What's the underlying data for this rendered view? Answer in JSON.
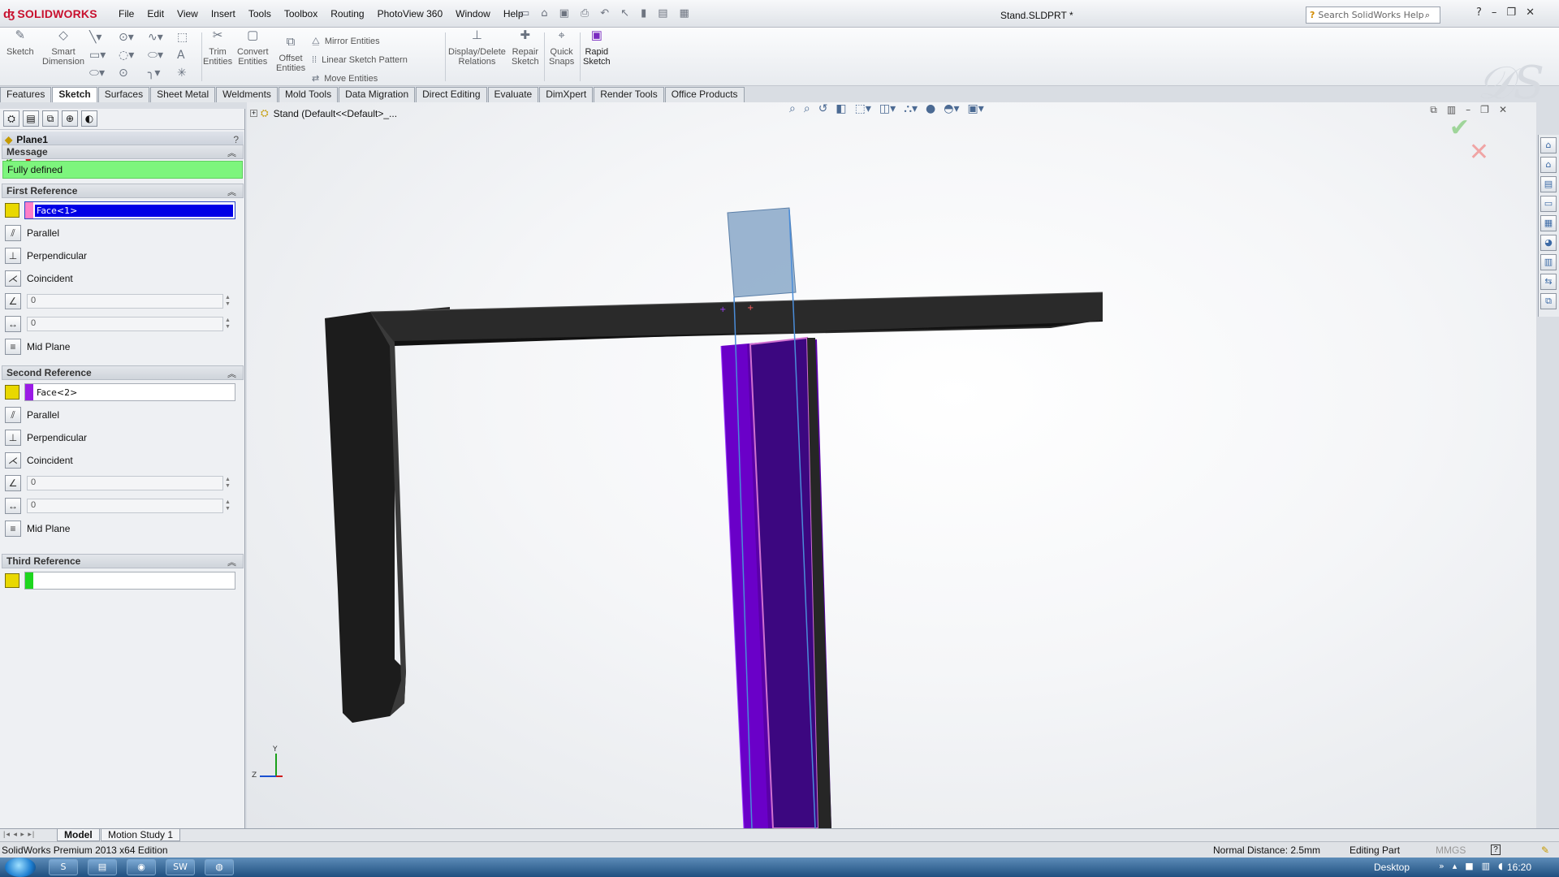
{
  "app": {
    "logo_text": "SOLIDWORKS",
    "menus": [
      "File",
      "Edit",
      "View",
      "Insert",
      "Tools",
      "Toolbox",
      "Routing",
      "PhotoView 360",
      "Window",
      "Help"
    ],
    "document_title": "Stand.SLDPRT *",
    "search_placeholder": "Search SolidWorks Help"
  },
  "command_manager": {
    "sketch": "Sketch",
    "smart_dimension_1": "Smart",
    "smart_dimension_2": "Dimension",
    "trim_1": "Trim",
    "trim_2": "Entities",
    "convert_1": "Convert",
    "convert_2": "Entities",
    "offset_1": "Offset",
    "offset_2": "Entities",
    "mirror": "Mirror Entities",
    "linear_pattern": "Linear Sketch Pattern",
    "move": "Move Entities",
    "display_delete_1": "Display/Delete",
    "display_delete_2": "Relations",
    "repair_1": "Repair",
    "repair_2": "Sketch",
    "quick_snaps_1": "Quick",
    "quick_snaps_2": "Snaps",
    "rapid_1": "Rapid",
    "rapid_2": "Sketch"
  },
  "tabs": [
    "Features",
    "Sketch",
    "Surfaces",
    "Sheet Metal",
    "Weldments",
    "Mold Tools",
    "Data Migration",
    "Direct Editing",
    "Evaluate",
    "DimXpert",
    "Render Tools",
    "Office Products"
  ],
  "active_tab": "Sketch",
  "property_manager": {
    "title": "Plane1",
    "help": "?",
    "message_header": "Message",
    "message_text": "Fully defined",
    "message_color": "#7df57d",
    "first_reference": {
      "header": "First Reference",
      "selection": "Face<1>",
      "swatch_color": "#ff7fc8",
      "parallel": "Parallel",
      "perpendicular": "Perpendicular",
      "coincident": "Coincident",
      "angle_value": "0",
      "distance_value": "0",
      "mid_plane": "Mid Plane"
    },
    "second_reference": {
      "header": "Second Reference",
      "selection": "Face<2>",
      "swatch_color": "#9b1be6",
      "parallel": "Parallel",
      "perpendicular": "Perpendicular",
      "coincident": "Coincident",
      "angle_value": "0",
      "distance_value": "0",
      "mid_plane": "Mid Plane"
    },
    "third_reference": {
      "header": "Third Reference",
      "selection": "",
      "swatch_color": "#1ed61e"
    }
  },
  "viewport": {
    "tree_root": "Stand  (Default<<Default>_...",
    "triad_y": "Y",
    "triad_z": "Z"
  },
  "bottom_tabs": [
    "Model",
    "Motion Study 1"
  ],
  "status": {
    "edition": "SolidWorks Premium 2013 x64 Edition",
    "normal_distance": "Normal Distance: 2.5mm",
    "mode": "Editing Part",
    "units": "MMGS"
  },
  "taskbar": {
    "desktop": "Desktop",
    "clock": "16:20"
  }
}
